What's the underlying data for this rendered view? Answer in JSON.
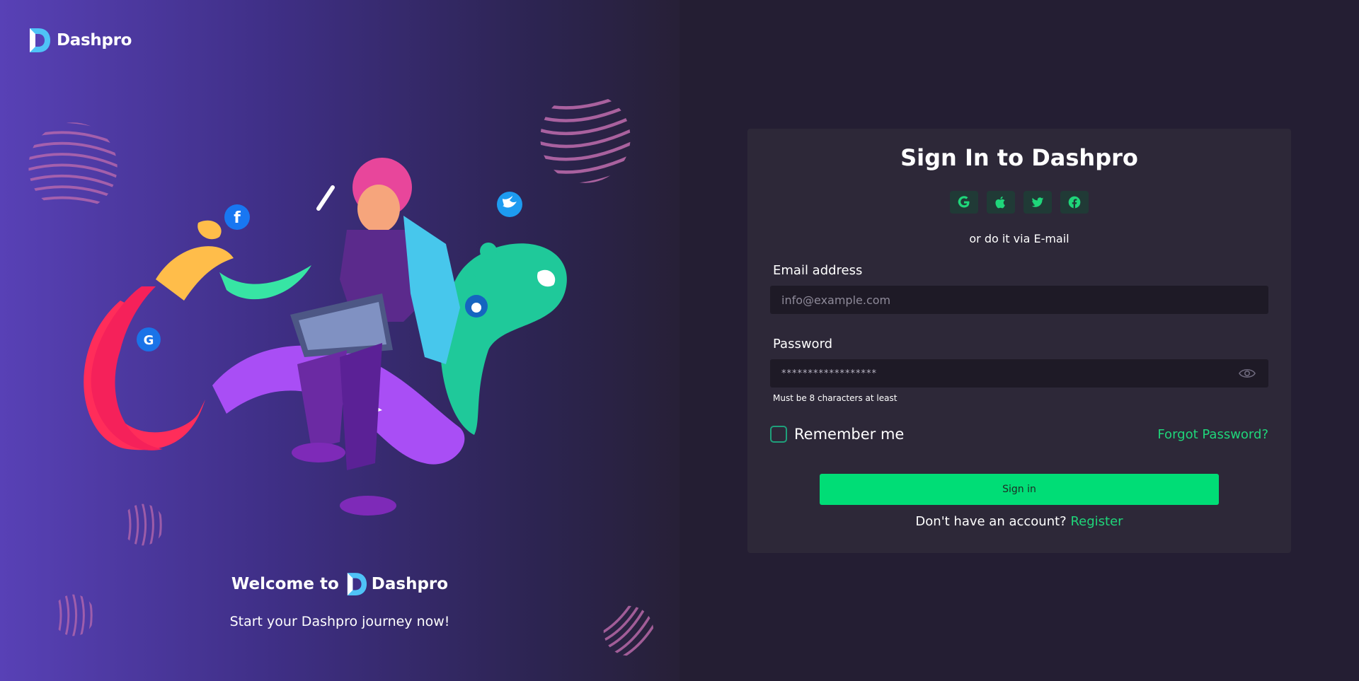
{
  "brand": {
    "name": "Dashpro",
    "logo_icon": "dashpro-logo-icon",
    "logo_colors": [
      "#4fc3f7",
      "#1e88e5"
    ]
  },
  "left_panel": {
    "welcome_prefix": "Welcome to",
    "welcome_brand": "Dashpro",
    "tagline": "Start your Dashpro journey now!"
  },
  "signin": {
    "title": "Sign In to Dashpro",
    "social_buttons": [
      {
        "icon": "google-icon"
      },
      {
        "icon": "apple-icon"
      },
      {
        "icon": "twitter-icon"
      },
      {
        "icon": "facebook-icon"
      }
    ],
    "divider_text": "or do it via E-mail",
    "email": {
      "label": "Email address",
      "placeholder": "info@example.com",
      "value": ""
    },
    "password": {
      "label": "Password",
      "value": "******************",
      "hint": "Must be 8 characters at least",
      "toggle_icon": "eye-icon"
    },
    "remember_label": "Remember me",
    "forgot_label": "Forgot Password?",
    "submit_label": "Sign in",
    "register_prompt": "Don't have an account?",
    "register_label": "Register"
  },
  "colors": {
    "accent": "#00dd76",
    "link": "#1fd67a",
    "card_bg": "#2d2838",
    "page_bg": "#241e33",
    "input_bg": "#1e1a26"
  }
}
